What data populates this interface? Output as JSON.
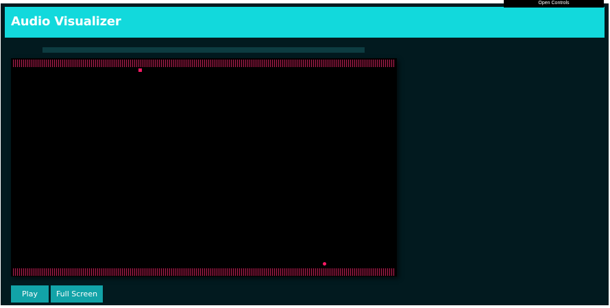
{
  "app": {
    "title": "Audio Visualizer",
    "open_controls_label": "Open Controls"
  },
  "playback": {
    "progress": 0.0,
    "buttons": {
      "play_label": "Play",
      "fullscreen_label": "Full Screen"
    }
  },
  "colors": {
    "header": "#12d9dc",
    "background": "#021a1f",
    "canvas": "#000000",
    "bars": "#a8204e",
    "accent_dot": "#ff1a66",
    "buttons": "#12a3a8"
  }
}
